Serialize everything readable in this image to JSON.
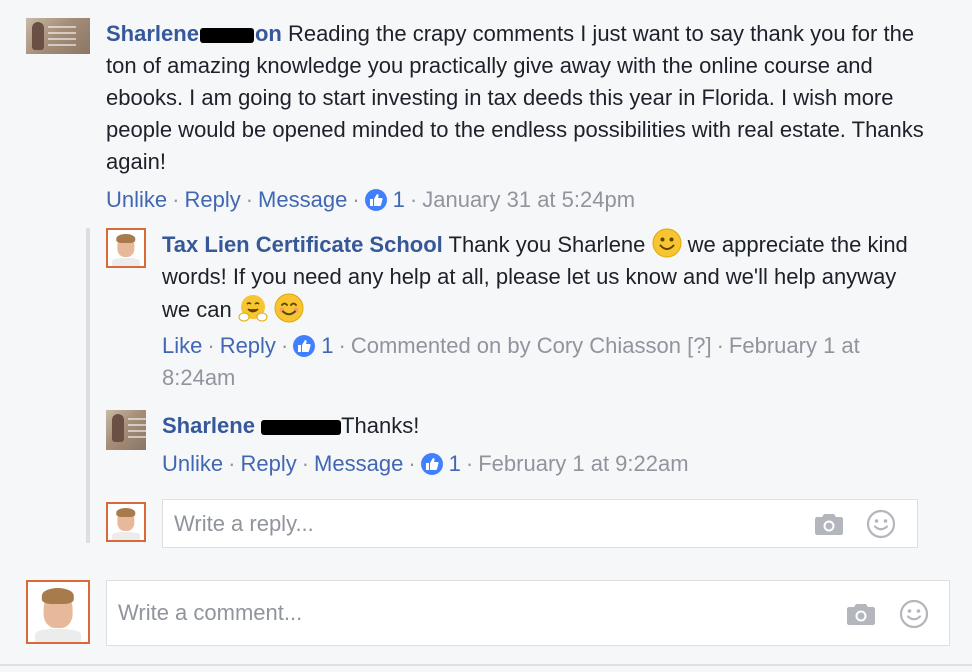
{
  "comment1": {
    "author_first": "Sharlene",
    "author_tail": "on",
    "text": "Reading the crapy comments I just want to say thank you for the ton of amazing knowledge you practically give away with the online course and ebooks. I am going to start investing in tax deeds this year in Florida. I wish more people would be opened minded to the endless possibilities with real estate. Thanks again!",
    "actions": {
      "unlike": "Unlike",
      "reply": "Reply",
      "message": "Message",
      "likes": "1",
      "timestamp": "January 31 at 5:24pm"
    }
  },
  "reply1": {
    "author": "Tax Lien Certificate School",
    "text_a": "Thank you Sharlene",
    "text_b": "we appreciate the kind words! If you need any help at all, please let us know and we'll help anyway we can",
    "actions": {
      "like": "Like",
      "reply": "Reply",
      "likes": "1",
      "commented_by": "Commented on by Cory Chiasson",
      "help_mark": "[?]",
      "timestamp": "February 1 at 8:24am"
    }
  },
  "reply2": {
    "author_first": "Sharlene",
    "text": "Thanks!",
    "actions": {
      "unlike": "Unlike",
      "reply": "Reply",
      "message": "Message",
      "likes": "1",
      "timestamp": "February 1 at 9:22am"
    }
  },
  "reply_input": {
    "placeholder": "Write a reply..."
  },
  "comment_input": {
    "placeholder": "Write a comment..."
  },
  "colors": {
    "name_blue": "#365899",
    "link_blue": "#4267b2",
    "meta_grey": "#90949c",
    "like_blue": "#4080ff",
    "avatar_border": "#d86a39"
  }
}
